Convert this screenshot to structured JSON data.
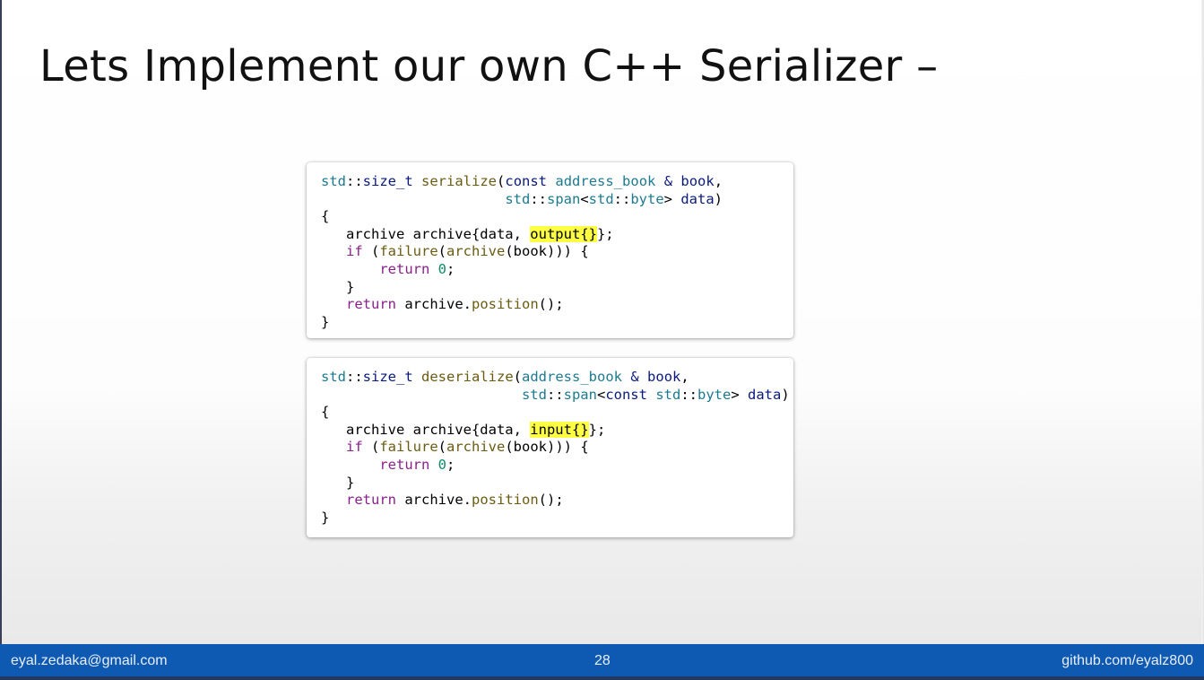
{
  "slide": {
    "title": "Lets Implement our own C++ Serializer –"
  },
  "footer": {
    "email": "eyal.zedaka@gmail.com",
    "page_number": "28",
    "github": "github.com/eyalz800"
  },
  "code_blocks": [
    {
      "name": "serialize",
      "lines": [
        [
          [
            "ty",
            "std"
          ],
          [
            "pl",
            "::"
          ],
          [
            "kw",
            "size_t"
          ],
          [
            "pl",
            " "
          ],
          [
            "fn",
            "serialize"
          ],
          [
            "pl",
            "("
          ],
          [
            "kw",
            "const"
          ],
          [
            "pl",
            " "
          ],
          [
            "ty",
            "address_book"
          ],
          [
            "pl",
            " "
          ],
          [
            "kw",
            "&"
          ],
          [
            "pl",
            " "
          ],
          [
            "kw",
            "book"
          ],
          [
            "pl",
            ","
          ]
        ],
        [
          [
            "pl",
            "                      "
          ],
          [
            "ty",
            "std"
          ],
          [
            "pl",
            "::"
          ],
          [
            "ty",
            "span"
          ],
          [
            "pl",
            "<"
          ],
          [
            "ty",
            "std"
          ],
          [
            "pl",
            "::"
          ],
          [
            "ty",
            "byte"
          ],
          [
            "pl",
            "> "
          ],
          [
            "kw",
            "data"
          ],
          [
            "pl",
            ")"
          ]
        ],
        [
          [
            "pl",
            "{"
          ]
        ],
        [
          [
            "pl",
            "   archive archive{data, "
          ],
          [
            "hl",
            "output{}"
          ],
          [
            "pl",
            "};"
          ]
        ],
        [
          [
            "pl",
            "   "
          ],
          [
            "kp",
            "if"
          ],
          [
            "pl",
            " ("
          ],
          [
            "fn",
            "failure"
          ],
          [
            "pl",
            "("
          ],
          [
            "fn",
            "archive"
          ],
          [
            "pl",
            "(book))) {"
          ]
        ],
        [
          [
            "pl",
            "       "
          ],
          [
            "kp",
            "return"
          ],
          [
            "pl",
            " "
          ],
          [
            "num",
            "0"
          ],
          [
            "pl",
            ";"
          ]
        ],
        [
          [
            "pl",
            "   }"
          ]
        ],
        [
          [
            "pl",
            "   "
          ],
          [
            "kp",
            "return"
          ],
          [
            "pl",
            " archive."
          ],
          [
            "fn",
            "position"
          ],
          [
            "pl",
            "();"
          ]
        ],
        [
          [
            "pl",
            "}"
          ]
        ]
      ]
    },
    {
      "name": "deserialize",
      "lines": [
        [
          [
            "ty",
            "std"
          ],
          [
            "pl",
            "::"
          ],
          [
            "kw",
            "size_t"
          ],
          [
            "pl",
            " "
          ],
          [
            "fn",
            "deserialize"
          ],
          [
            "pl",
            "("
          ],
          [
            "ty",
            "address_book"
          ],
          [
            "pl",
            " "
          ],
          [
            "kw",
            "&"
          ],
          [
            "pl",
            " "
          ],
          [
            "kw",
            "book"
          ],
          [
            "pl",
            ","
          ]
        ],
        [
          [
            "pl",
            "                        "
          ],
          [
            "ty",
            "std"
          ],
          [
            "pl",
            "::"
          ],
          [
            "ty",
            "span"
          ],
          [
            "pl",
            "<"
          ],
          [
            "kw",
            "const"
          ],
          [
            "pl",
            " "
          ],
          [
            "ty",
            "std"
          ],
          [
            "pl",
            "::"
          ],
          [
            "ty",
            "byte"
          ],
          [
            "pl",
            "> "
          ],
          [
            "kw",
            "data"
          ],
          [
            "pl",
            ")"
          ]
        ],
        [
          [
            "pl",
            "{"
          ]
        ],
        [
          [
            "pl",
            "   archive archive{data, "
          ],
          [
            "hl",
            "input{}"
          ],
          [
            "pl",
            "};"
          ]
        ],
        [
          [
            "pl",
            "   "
          ],
          [
            "kp",
            "if"
          ],
          [
            "pl",
            " ("
          ],
          [
            "fn",
            "failure"
          ],
          [
            "pl",
            "("
          ],
          [
            "fn",
            "archive"
          ],
          [
            "pl",
            "(book))) {"
          ]
        ],
        [
          [
            "pl",
            "       "
          ],
          [
            "kp",
            "return"
          ],
          [
            "pl",
            " "
          ],
          [
            "num",
            "0"
          ],
          [
            "pl",
            ";"
          ]
        ],
        [
          [
            "pl",
            "   }"
          ]
        ],
        [
          [
            "pl",
            "   "
          ],
          [
            "kp",
            "return"
          ],
          [
            "pl",
            " archive."
          ],
          [
            "fn",
            "position"
          ],
          [
            "pl",
            "();"
          ]
        ],
        [
          [
            "pl",
            "}"
          ]
        ]
      ]
    }
  ]
}
